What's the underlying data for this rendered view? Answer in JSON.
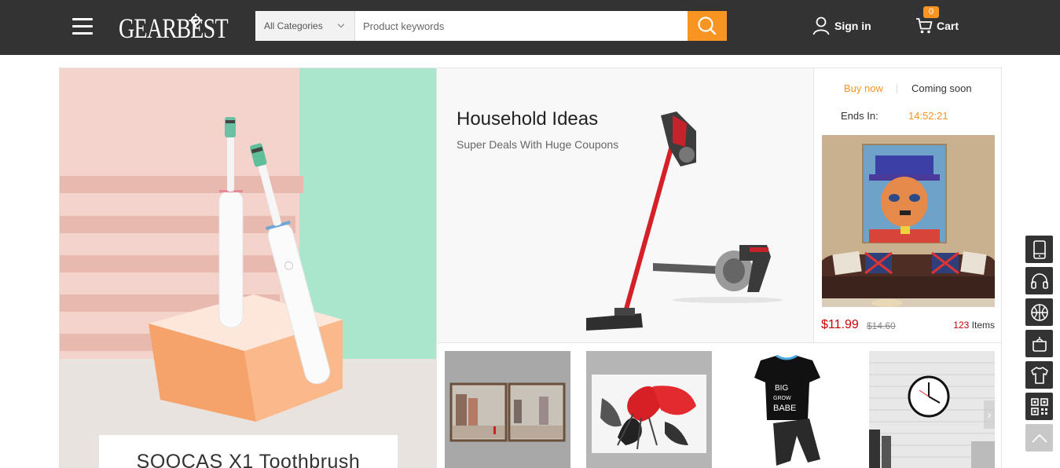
{
  "header": {
    "logo_text": "GEARBEST",
    "search": {
      "category_label": "All Categories",
      "placeholder": "Product keywords"
    },
    "signin_label": "Sign in",
    "cart": {
      "label": "Cart",
      "count": "0"
    }
  },
  "hero": {
    "caption": "SOOCAS X1 Toothbrush"
  },
  "banner": {
    "title": "Household Ideas",
    "subtitle": "Super Deals With Huge Coupons"
  },
  "deal": {
    "tab_buy": "Buy now",
    "tab_soon": "Coming soon",
    "ends_label": "Ends In:",
    "ends_time": "14:52:21",
    "price": "$11.99",
    "old_price": "$14.60",
    "items_count": "123",
    "items_label": " Items"
  },
  "products": [
    {
      "name": "city painting canvas"
    },
    {
      "name": "abstract red flower canvas"
    },
    {
      "name": "kids t-shirt pants set"
    },
    {
      "name": "wall clock"
    }
  ],
  "sidenav": [
    "phone-icon",
    "headphones-icon",
    "ball-icon",
    "pot-icon",
    "tshirt-icon",
    "qr-code-icon",
    "back-to-top-icon"
  ],
  "colors": {
    "accent": "#f79422",
    "header_bg": "#333333",
    "price_red": "#cc0000"
  }
}
